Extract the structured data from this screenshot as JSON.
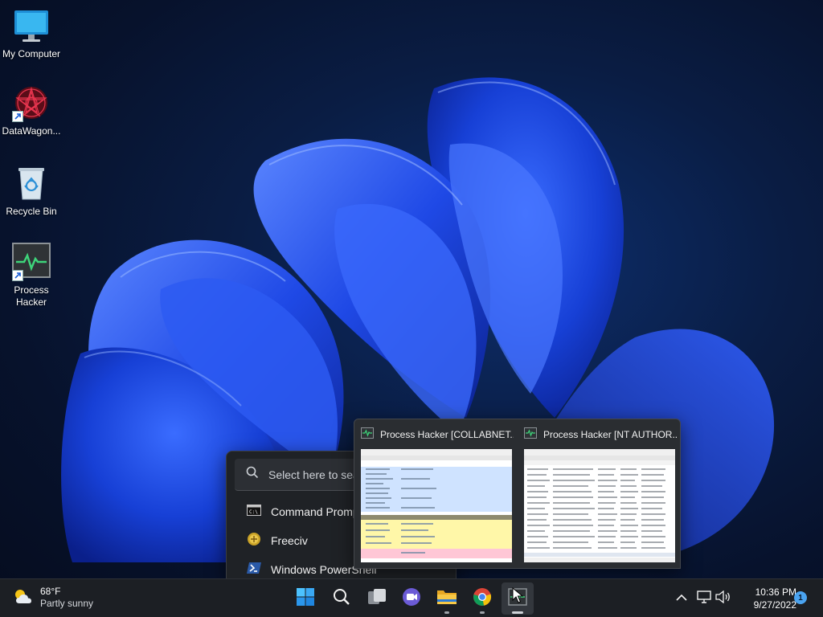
{
  "desktop": {
    "icons": [
      {
        "label": "My Computer",
        "icon": "monitor-icon"
      },
      {
        "label": "DataWagon...",
        "icon": "datawagon-icon",
        "shortcut": true
      },
      {
        "label": "Recycle Bin",
        "icon": "recycle-bin-icon"
      },
      {
        "label": "Process Hacker",
        "icon": "process-hacker-icon",
        "shortcut": true
      }
    ]
  },
  "search_popup": {
    "placeholder": "Select here to search",
    "apps": [
      {
        "label": "Command Prompt",
        "icon": "command-prompt-icon"
      },
      {
        "label": "Freeciv",
        "icon": "freeciv-icon"
      },
      {
        "label": "Windows PowerShell",
        "icon": "powershell-icon"
      }
    ]
  },
  "thumbnails": [
    {
      "title": "Process Hacker [COLLABNET...",
      "icon": "process-hacker-icon"
    },
    {
      "title": "Process Hacker [NT AUTHOR...",
      "icon": "process-hacker-icon"
    }
  ],
  "taskbar": {
    "weather": {
      "temp": "68°F",
      "condition": "Partly sunny",
      "icon": "partly-sunny-icon"
    },
    "apps": [
      {
        "name": "Start",
        "icon": "windows-start-icon"
      },
      {
        "name": "Search",
        "icon": "search-icon"
      },
      {
        "name": "Task View",
        "icon": "task-view-icon"
      },
      {
        "name": "Chat",
        "icon": "chat-icon"
      },
      {
        "name": "File Explorer",
        "icon": "folder-icon",
        "running": true
      },
      {
        "name": "Google Chrome",
        "icon": "chrome-icon",
        "running": true
      },
      {
        "name": "Process Hacker",
        "icon": "process-hacker-icon",
        "running": true,
        "active": true
      }
    ],
    "tray": {
      "icons": [
        "chevron-up-icon",
        "network-icon",
        "volume-icon"
      ],
      "time": "10:36 PM",
      "date": "9/27/2022",
      "notification_count": "1"
    }
  },
  "colors": {
    "taskbar_bg": "#1c1f24",
    "popup_bg": "#1f2226",
    "accent": "#4aa3f0",
    "wallpaper_blue": "#1a4bd8"
  }
}
